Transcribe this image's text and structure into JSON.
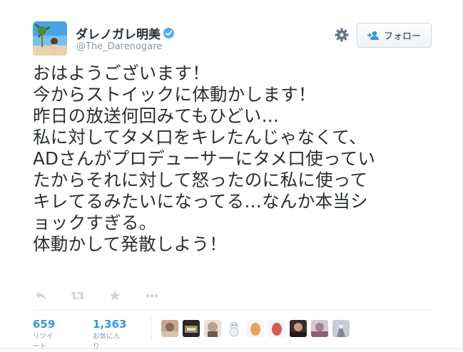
{
  "user": {
    "display_name": "ダレノガレ明美",
    "handle": "@The_Darenogare",
    "verified": true
  },
  "follow_button": {
    "label": "フォロー"
  },
  "tweet": {
    "text": "おはようございます！\n今からストイックに体動かします！\n昨日の放送何回みてもひどい…\n私に対してタメ口をキレたんじゃなくて、\nADさんがプロデューサーにタメ口使ってい\nたからそれに対して怒ったのに私に使って\nキレてるみたいになってる…なんか本当シ\nョックすぎる。\n体動かして発散しよう！"
  },
  "actions": [
    "reply-icon",
    "retweet-icon",
    "favorite-icon",
    "more-icon"
  ],
  "stats": {
    "retweets": {
      "count": "659",
      "label": "リツイート"
    },
    "favorites": {
      "count": "1,363",
      "label": "お気に入り"
    }
  },
  "colors": {
    "link_blue": "#3b94d9",
    "verified_blue": "#55acee",
    "muted": "#8899a6",
    "text": "#292f33",
    "border": "#e1e8ed"
  },
  "favoriter_avatars": [
    {
      "name": "favoriter-avatar-1"
    },
    {
      "name": "favoriter-avatar-2"
    },
    {
      "name": "favoriter-avatar-3"
    },
    {
      "name": "favoriter-avatar-4"
    },
    {
      "name": "favoriter-avatar-5"
    },
    {
      "name": "favoriter-avatar-6"
    },
    {
      "name": "favoriter-avatar-7"
    },
    {
      "name": "favoriter-avatar-8"
    },
    {
      "name": "favoriter-avatar-9"
    }
  ]
}
